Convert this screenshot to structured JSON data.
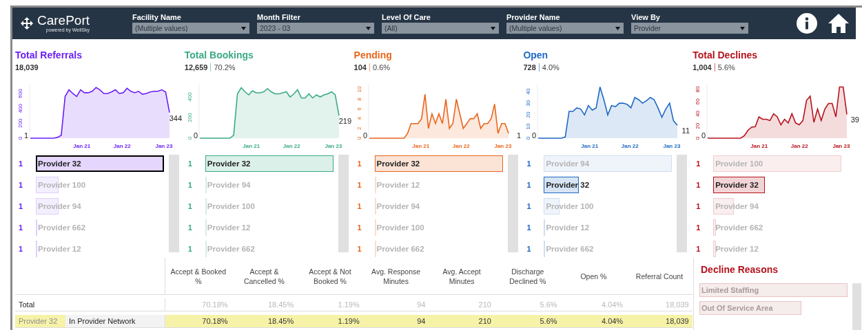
{
  "header": {
    "logo": "CarePort",
    "logo_tagline": "powered by WellSky",
    "filters": [
      {
        "label": "Facility Name",
        "value": "(Multiple values)"
      },
      {
        "label": "Month Filter",
        "value": "2023 - 03"
      },
      {
        "label": "Level Of Care",
        "value": "(All)"
      },
      {
        "label": "Provider Name",
        "value": "(Multiple values)"
      },
      {
        "label": "View By",
        "value": "Provider"
      }
    ]
  },
  "metrics": [
    {
      "title": "Total Referrals",
      "color": "#6a1ef5",
      "count": "18,039",
      "scrollable": true,
      "chart": {
        "start_label": "1",
        "end_label": "344",
        "x_labels": [
          "Jan 21",
          "Jan 22",
          "Jan 23"
        ],
        "chart_data": {
          "type": "area",
          "ylim": [
            0,
            720
          ],
          "yticks": [
            0,
            200,
            400,
            600
          ],
          "series": [
            {
              "color": "#6a1ef5",
              "values": [
                0,
                0,
                0,
                0,
                0,
                0,
                0,
                10,
                40,
                560,
                650,
                600,
                560,
                650,
                610,
                610,
                630,
                680,
                650,
                600,
                600,
                620,
                650,
                600,
                610,
                670,
                630,
                610,
                630,
                590,
                600,
                620,
                630,
                630,
                650,
                620,
                344
              ]
            }
          ]
        }
      },
      "providers": [
        {
          "rank": "1",
          "name": "Provider 32",
          "selected": true,
          "focused": true
        },
        {
          "rank": "1",
          "name": "Provider 100",
          "selected": false,
          "focused": false
        },
        {
          "rank": "1",
          "name": "Provider 94",
          "selected": false,
          "focused": false
        },
        {
          "rank": "1",
          "name": "Provider 662",
          "selected": false,
          "focused": false
        },
        {
          "rank": "1",
          "name": "Provider 12",
          "selected": false,
          "focused": false
        }
      ]
    },
    {
      "title": "Total Bookings",
      "color": "#3aaa84",
      "count": "12,659",
      "share": "70.2%",
      "scrollable": true,
      "chart": {
        "start_label": "0",
        "end_label": "219",
        "x_labels": [
          "Jan 21",
          "Jan 22",
          "Jan 23"
        ],
        "chart_data": {
          "type": "area",
          "ylim": [
            0,
            520
          ],
          "yticks": [
            0,
            200,
            400
          ],
          "series": [
            {
              "color": "#3aaa84",
              "values": [
                0,
                0,
                0,
                0,
                0,
                0,
                0,
                0,
                0,
                30,
                430,
                490,
                450,
                420,
                460,
                440,
                440,
                450,
                480,
                450,
                430,
                430,
                440,
                450,
                400,
                430,
                470,
                390,
                390,
                430,
                390,
                420,
                400,
                420,
                430,
                450,
                420,
                219
              ]
            }
          ]
        }
      },
      "providers": [
        {
          "rank": "1",
          "name": "Provider 32",
          "selected": true,
          "focused": false
        },
        {
          "rank": "1",
          "name": "Provider 94",
          "selected": false,
          "focused": false
        },
        {
          "rank": "1",
          "name": "Provider 100",
          "selected": false,
          "focused": false
        },
        {
          "rank": "1",
          "name": "Provider 12",
          "selected": false,
          "focused": false
        },
        {
          "rank": "1",
          "name": "Provider 662",
          "selected": false,
          "focused": false
        }
      ]
    },
    {
      "title": "Pending",
      "color": "#e8661c",
      "count": "104",
      "share": "0.6%",
      "scrollable": true,
      "chart": {
        "start_label": "0",
        "end_label": "1",
        "x_labels": [
          "Jan 21",
          "Jan 22",
          "Jan 23"
        ],
        "chart_data": {
          "type": "area",
          "ylim": [
            0,
            11
          ],
          "yticks": [
            0,
            2,
            4,
            6,
            8,
            10
          ],
          "series": [
            {
              "color": "#e8661c",
              "values": [
                0,
                0,
                0,
                0,
                0,
                0,
                0,
                0,
                0,
                0,
                0,
                1,
                3,
                3,
                3,
                4,
                9,
                2,
                5,
                3,
                5,
                3,
                8,
                2,
                3,
                8,
                5,
                2,
                3,
                4,
                4,
                5,
                2,
                3,
                3,
                4,
                7,
                1,
                3,
                3,
                1
              ]
            }
          ]
        }
      },
      "providers": [
        {
          "rank": "1",
          "name": "Provider 32",
          "selected": true,
          "focused": false
        },
        {
          "rank": "1",
          "name": "Provider 12",
          "selected": false,
          "focused": false
        },
        {
          "rank": "1",
          "name": "Provider 94",
          "selected": false,
          "focused": false
        },
        {
          "rank": "1",
          "name": "Provider 100",
          "selected": false,
          "focused": false
        },
        {
          "rank": "1",
          "name": "Provider 662",
          "selected": false,
          "focused": false
        }
      ]
    },
    {
      "title": "Open",
      "color": "#1d68c4",
      "count": "728",
      "share": "4.0%",
      "scrollable": true,
      "chart": {
        "start_label": "0",
        "end_label": "11",
        "x_labels": [
          "Jan 21",
          "Jan 22",
          "Jan 23"
        ],
        "chart_data": {
          "type": "area",
          "ylim": [
            0,
            46
          ],
          "yticks": [
            0,
            10,
            20,
            30,
            40
          ],
          "series": [
            {
              "color": "#1d68c4",
              "values": [
                0,
                0,
                0,
                0,
                0,
                0,
                0,
                1,
                23,
                23,
                26,
                25,
                20,
                28,
                24,
                26,
                44,
                33,
                20,
                28,
                27,
                30,
                30,
                29,
                26,
                35,
                33,
                30,
                32,
                35,
                33,
                26,
                18,
                25,
                30,
                15,
                11
              ]
            }
          ]
        }
      },
      "providers": [
        {
          "rank": "1",
          "name": "Provider 94",
          "selected": false,
          "focused": false
        },
        {
          "rank": "1",
          "name": "Provider 32",
          "selected": true,
          "focused": false
        },
        {
          "rank": "1",
          "name": "Provider 100",
          "selected": false,
          "focused": false
        },
        {
          "rank": "1",
          "name": "Provider 12",
          "selected": false,
          "focused": false
        },
        {
          "rank": "1",
          "name": "Provider 662",
          "selected": false,
          "focused": false
        }
      ]
    },
    {
      "title": "Total Declines",
      "color": "#b5121b",
      "count": "1,004",
      "share": "5.6%",
      "scrollable": false,
      "chart": {
        "start_label": "0",
        "end_label": "39",
        "x_labels": [
          "Jan 21",
          "Jan 22",
          "Jan 23"
        ],
        "chart_data": {
          "type": "area",
          "ylim": [
            0,
            88
          ],
          "yticks": [
            0,
            20,
            40,
            60,
            80
          ],
          "series": [
            {
              "color": "#b5121b",
              "values": [
                0,
                0,
                0,
                0,
                0,
                0,
                0,
                0,
                0,
                0,
                4,
                13,
                18,
                19,
                35,
                31,
                31,
                29,
                40,
                35,
                22,
                31,
                25,
                40,
                25,
                22,
                29,
                62,
                69,
                26,
                48,
                29,
                48,
                57,
                57,
                35,
                84,
                84,
                39
              ]
            }
          ]
        }
      },
      "providers": [
        {
          "rank": "1",
          "name": "Provider 100",
          "selected": false,
          "focused": false
        },
        {
          "rank": "1",
          "name": "Provider 32",
          "selected": true,
          "focused": false
        },
        {
          "rank": "1",
          "name": "Provider 94",
          "selected": false,
          "focused": false
        },
        {
          "rank": "1",
          "name": "Provider 662",
          "selected": false,
          "focused": false
        },
        {
          "rank": "1",
          "name": "Provider 12",
          "selected": false,
          "focused": false
        }
      ]
    }
  ],
  "table": {
    "columns": [
      "Accept & Booked %",
      "Accept & Cancelled %",
      "Accept & Not Booked %",
      "Avg. Response Minutes",
      "Avg. Accept Minutes",
      "Discharge Declined %",
      "Open %",
      "Referral Count"
    ],
    "rows": [
      {
        "kind": "total",
        "label": "Total",
        "selected": false,
        "values": [
          "70.18%",
          "18.45%",
          "1.19%",
          "94",
          "210",
          "5.6%",
          "4.04%",
          "18,039"
        ]
      },
      {
        "kind": "provider",
        "label": "Provider 32",
        "network": "In Provider Network",
        "selected": true,
        "values": [
          "70.18%",
          "18.45%",
          "1.19%",
          "94",
          "210",
          "5.6%",
          "4.04%",
          "18,039"
        ]
      }
    ]
  },
  "decline_reasons": {
    "title": "Decline Reasons",
    "scrollable": true,
    "items": [
      {
        "name": "Limited Staffing"
      },
      {
        "name": "Out Of Service Area"
      }
    ]
  }
}
